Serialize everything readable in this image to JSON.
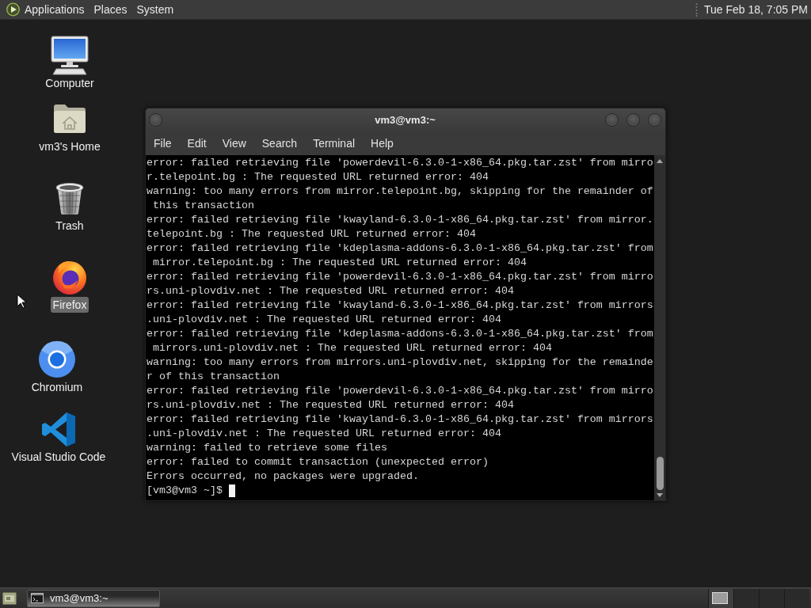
{
  "top_panel": {
    "menus": [
      "Applications",
      "Places",
      "System"
    ],
    "clock": "Tue Feb 18, 7:05 PM"
  },
  "desktop_icons": [
    {
      "kind": "computer",
      "label": "Computer",
      "selected": false
    },
    {
      "kind": "home",
      "label": "vm3's Home",
      "selected": false
    },
    {
      "kind": "trash",
      "label": "Trash",
      "selected": false
    },
    {
      "kind": "firefox",
      "label": "Firefox",
      "selected": true
    },
    {
      "kind": "chromium",
      "label": "Chromium",
      "selected": false
    },
    {
      "kind": "vscode",
      "label": "Visual Studio Code",
      "selected": false
    }
  ],
  "terminal_window": {
    "title": "vm3@vm3:~",
    "menu": [
      "File",
      "Edit",
      "View",
      "Search",
      "Terminal",
      "Help"
    ],
    "lines": [
      "error: failed retrieving file 'powerdevil-6.3.0-1-x86_64.pkg.tar.zst' from mirro",
      "r.telepoint.bg : The requested URL returned error: 404",
      "warning: too many errors from mirror.telepoint.bg, skipping for the remainder of",
      " this transaction",
      "error: failed retrieving file 'kwayland-6.3.0-1-x86_64.pkg.tar.zst' from mirror.",
      "telepoint.bg : The requested URL returned error: 404",
      "error: failed retrieving file 'kdeplasma-addons-6.3.0-1-x86_64.pkg.tar.zst' from",
      " mirror.telepoint.bg : The requested URL returned error: 404",
      "error: failed retrieving file 'powerdevil-6.3.0-1-x86_64.pkg.tar.zst' from mirro",
      "rs.uni-plovdiv.net : The requested URL returned error: 404",
      "error: failed retrieving file 'kwayland-6.3.0-1-x86_64.pkg.tar.zst' from mirrors",
      ".uni-plovdiv.net : The requested URL returned error: 404",
      "error: failed retrieving file 'kdeplasma-addons-6.3.0-1-x86_64.pkg.tar.zst' from",
      " mirrors.uni-plovdiv.net : The requested URL returned error: 404",
      "warning: too many errors from mirrors.uni-plovdiv.net, skipping for the remainde",
      "r of this transaction",
      "error: failed retrieving file 'powerdevil-6.3.0-1-x86_64.pkg.tar.zst' from mirro",
      "rs.uni-plovdiv.net : The requested URL returned error: 404",
      "error: failed retrieving file 'kwayland-6.3.0-1-x86_64.pkg.tar.zst' from mirrors",
      ".uni-plovdiv.net : The requested URL returned error: 404",
      "warning: failed to retrieve some files",
      "error: failed to commit transaction (unexpected error)",
      "Errors occurred, no packages were upgraded."
    ],
    "prompt": "[vm3@vm3 ~]$"
  },
  "bottom_panel": {
    "tasks": [
      {
        "label": "vm3@vm3:~",
        "selected": true
      }
    ],
    "workspaces": [
      {
        "selected": true
      },
      {
        "selected": false
      },
      {
        "selected": false
      },
      {
        "selected": false
      }
    ]
  }
}
